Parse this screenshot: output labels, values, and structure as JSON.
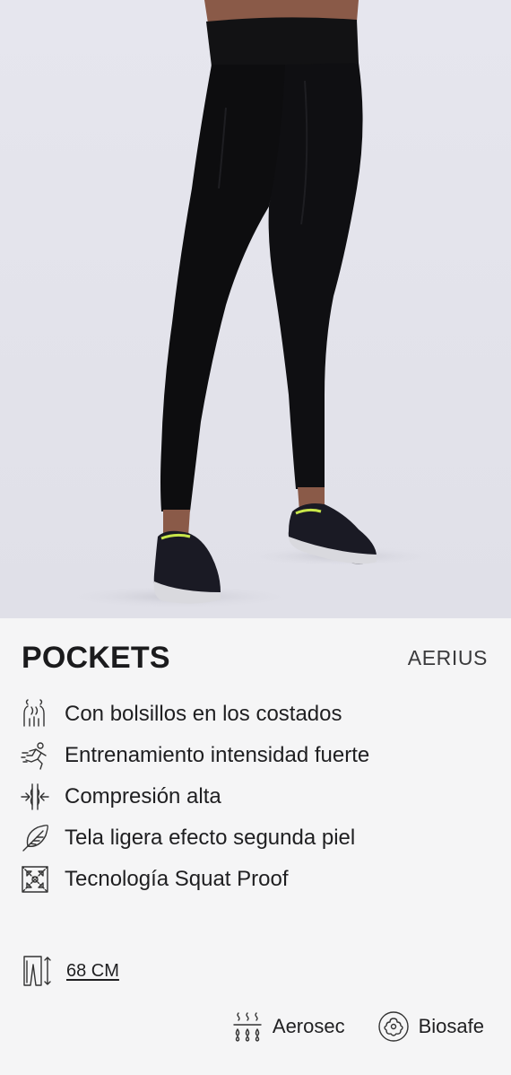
{
  "product": {
    "name": "POCKETS",
    "brand": "AERIUS"
  },
  "photo": {
    "alt_icon": "leggings-product-photo"
  },
  "features": [
    {
      "icon": "pockets-icon",
      "label": "Con bolsillos en los costados"
    },
    {
      "icon": "runner-icon",
      "label": "Entrenamiento intensidad fuerte"
    },
    {
      "icon": "compression-icon",
      "label": "Compresión alta"
    },
    {
      "icon": "feather-icon",
      "label": "Tela ligera efecto segunda piel"
    },
    {
      "icon": "squat-proof-icon",
      "label": "Tecnología Squat Proof"
    }
  ],
  "length": {
    "icon": "leg-length-icon",
    "label": "68 CM"
  },
  "technologies": [
    {
      "icon": "aerosec-icon",
      "label": "Aerosec"
    },
    {
      "icon": "biosafe-icon",
      "label": "Biosafe"
    }
  ],
  "colors": {
    "photo_background": "#e4e4ec",
    "card_background": "#f5f5f6",
    "text": "#1d1d1f",
    "legging": "#0d0d0f",
    "shoe_accent": "#c8e64a"
  }
}
